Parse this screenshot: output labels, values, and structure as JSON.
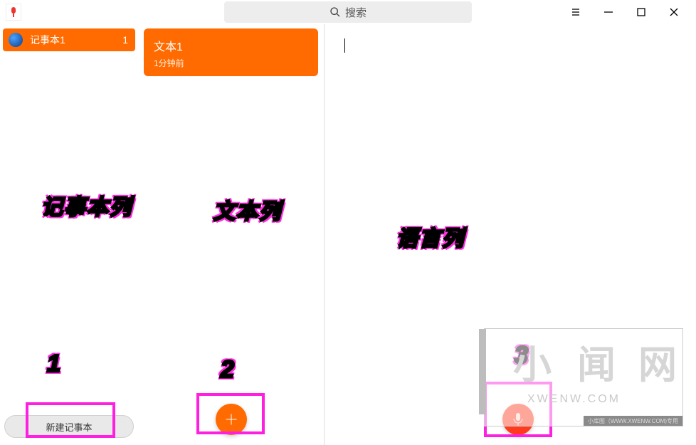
{
  "header": {
    "search_placeholder": "搜索"
  },
  "sidebar": {
    "notebooks": [
      {
        "name": "记事本1",
        "count": "1"
      }
    ],
    "new_notebook_label": "新建记事本"
  },
  "notes": [
    {
      "title": "文本1",
      "time": "1分钟前"
    }
  ],
  "annotations": {
    "col1_label": "记事本列",
    "col2_label": "文本列",
    "col3_label": "语言列",
    "num1": "1",
    "num2": "2",
    "num3": "3"
  },
  "watermark": {
    "brand_a": "小",
    "brand_b": "闻",
    "brand_c": "网",
    "domain": "XWENW.COM",
    "bar_text": "小库图（WWW.XWENW.COM)专用"
  }
}
